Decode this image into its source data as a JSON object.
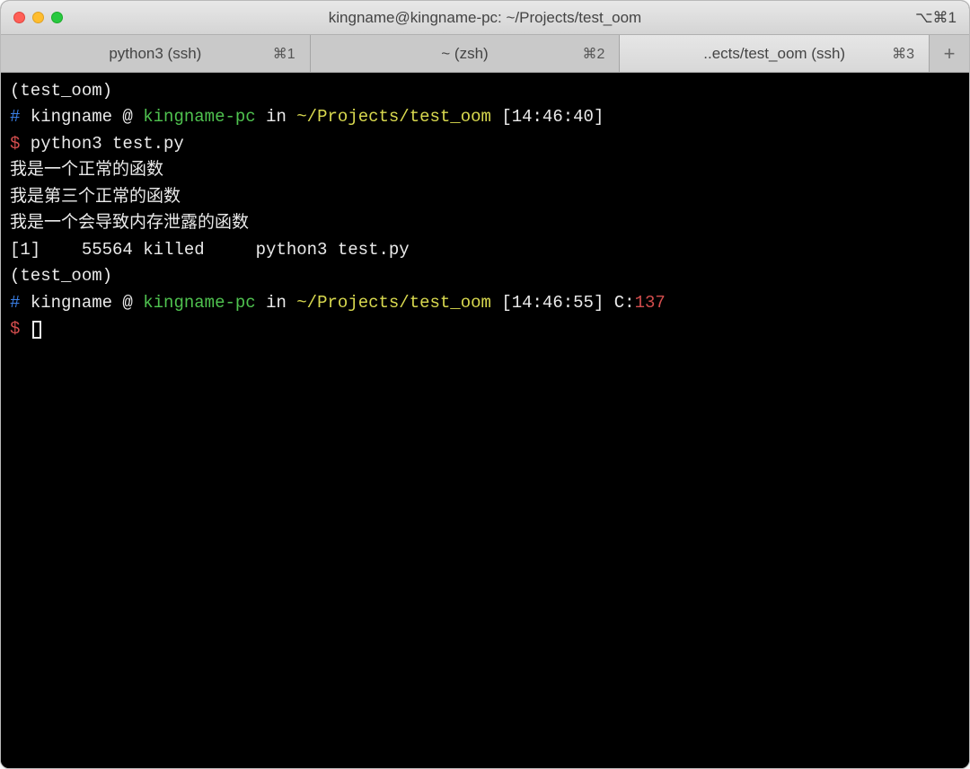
{
  "window": {
    "title": "kingname@kingname-pc: ~/Projects/test_oom",
    "shortcut": "⌥⌘1"
  },
  "tabs": [
    {
      "label": "python3 (ssh)",
      "shortcut": "⌘1",
      "active": false
    },
    {
      "label": "~ (zsh)",
      "shortcut": "⌘2",
      "active": false
    },
    {
      "label": "..ects/test_oom (ssh)",
      "shortcut": "⌘3",
      "active": true
    }
  ],
  "newtab": "+",
  "term": {
    "env1": "(test_oom)",
    "hash": "#",
    "user": "kingname",
    "at": " @ ",
    "host": "kingname-pc",
    "in": " in ",
    "path": "~/Projects/test_oom",
    "time1": " [14:46:40]",
    "dollar": "$",
    "cmd1": " python3 test.py",
    "out1": "我是一个正常的函数",
    "out2": "我是第三个正常的函数",
    "out3": "我是一个会导致内存泄露的函数",
    "out4": "[1]    55564 killed     python3 test.py",
    "env2": "(test_oom)",
    "time2": " [14:46:55] ",
    "cprefix": "C:",
    "ccode": "137"
  }
}
